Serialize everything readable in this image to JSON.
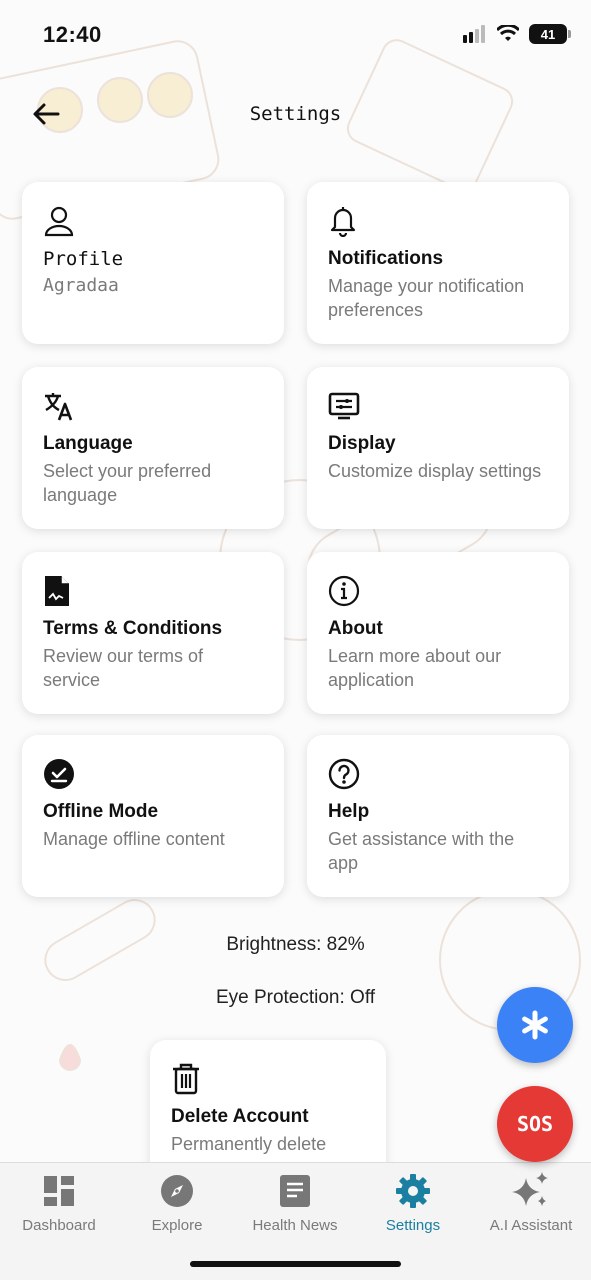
{
  "status_bar": {
    "time": "12:40",
    "battery": "41"
  },
  "header": {
    "title": "Settings"
  },
  "cards": [
    {
      "icon": "person-icon",
      "title": "Profile",
      "desc": "Agradaa"
    },
    {
      "icon": "bell-icon",
      "title": "Notifications",
      "desc": "Manage your notification preferences"
    },
    {
      "icon": "translate-icon",
      "title": "Language",
      "desc": "Select your preferred language"
    },
    {
      "icon": "display-icon",
      "title": "Display",
      "desc": "Customize display settings"
    },
    {
      "icon": "document-icon",
      "title": "Terms & Conditions",
      "desc": "Review our terms of service"
    },
    {
      "icon": "info-icon",
      "title": "About",
      "desc": "Learn more about our application"
    },
    {
      "icon": "offline-icon",
      "title": "Offline Mode",
      "desc": "Manage offline content"
    },
    {
      "icon": "help-icon",
      "title": "Help",
      "desc": "Get assistance with the app"
    },
    {
      "icon": "trash-icon",
      "title": "Delete Account",
      "desc": "Permanently delete"
    }
  ],
  "display_info": {
    "brightness": "Brightness: 82%",
    "eye_protection": "Eye Protection: Off"
  },
  "fab": {
    "ai_icon": "asterisk-icon",
    "sos_label": "SOS"
  },
  "nav": {
    "items": [
      {
        "label": "Dashboard",
        "icon": "dashboard-icon"
      },
      {
        "label": "Explore",
        "icon": "compass-icon"
      },
      {
        "label": "Health News",
        "icon": "news-icon"
      },
      {
        "label": "Settings",
        "icon": "gear-icon"
      },
      {
        "label": "A.I Assistant",
        "icon": "sparkle-icon"
      }
    ],
    "active": "Settings"
  },
  "colors": {
    "accent": "#1a7fa0",
    "ai_fab": "#3b82f6",
    "sos_fab": "#e53935"
  }
}
